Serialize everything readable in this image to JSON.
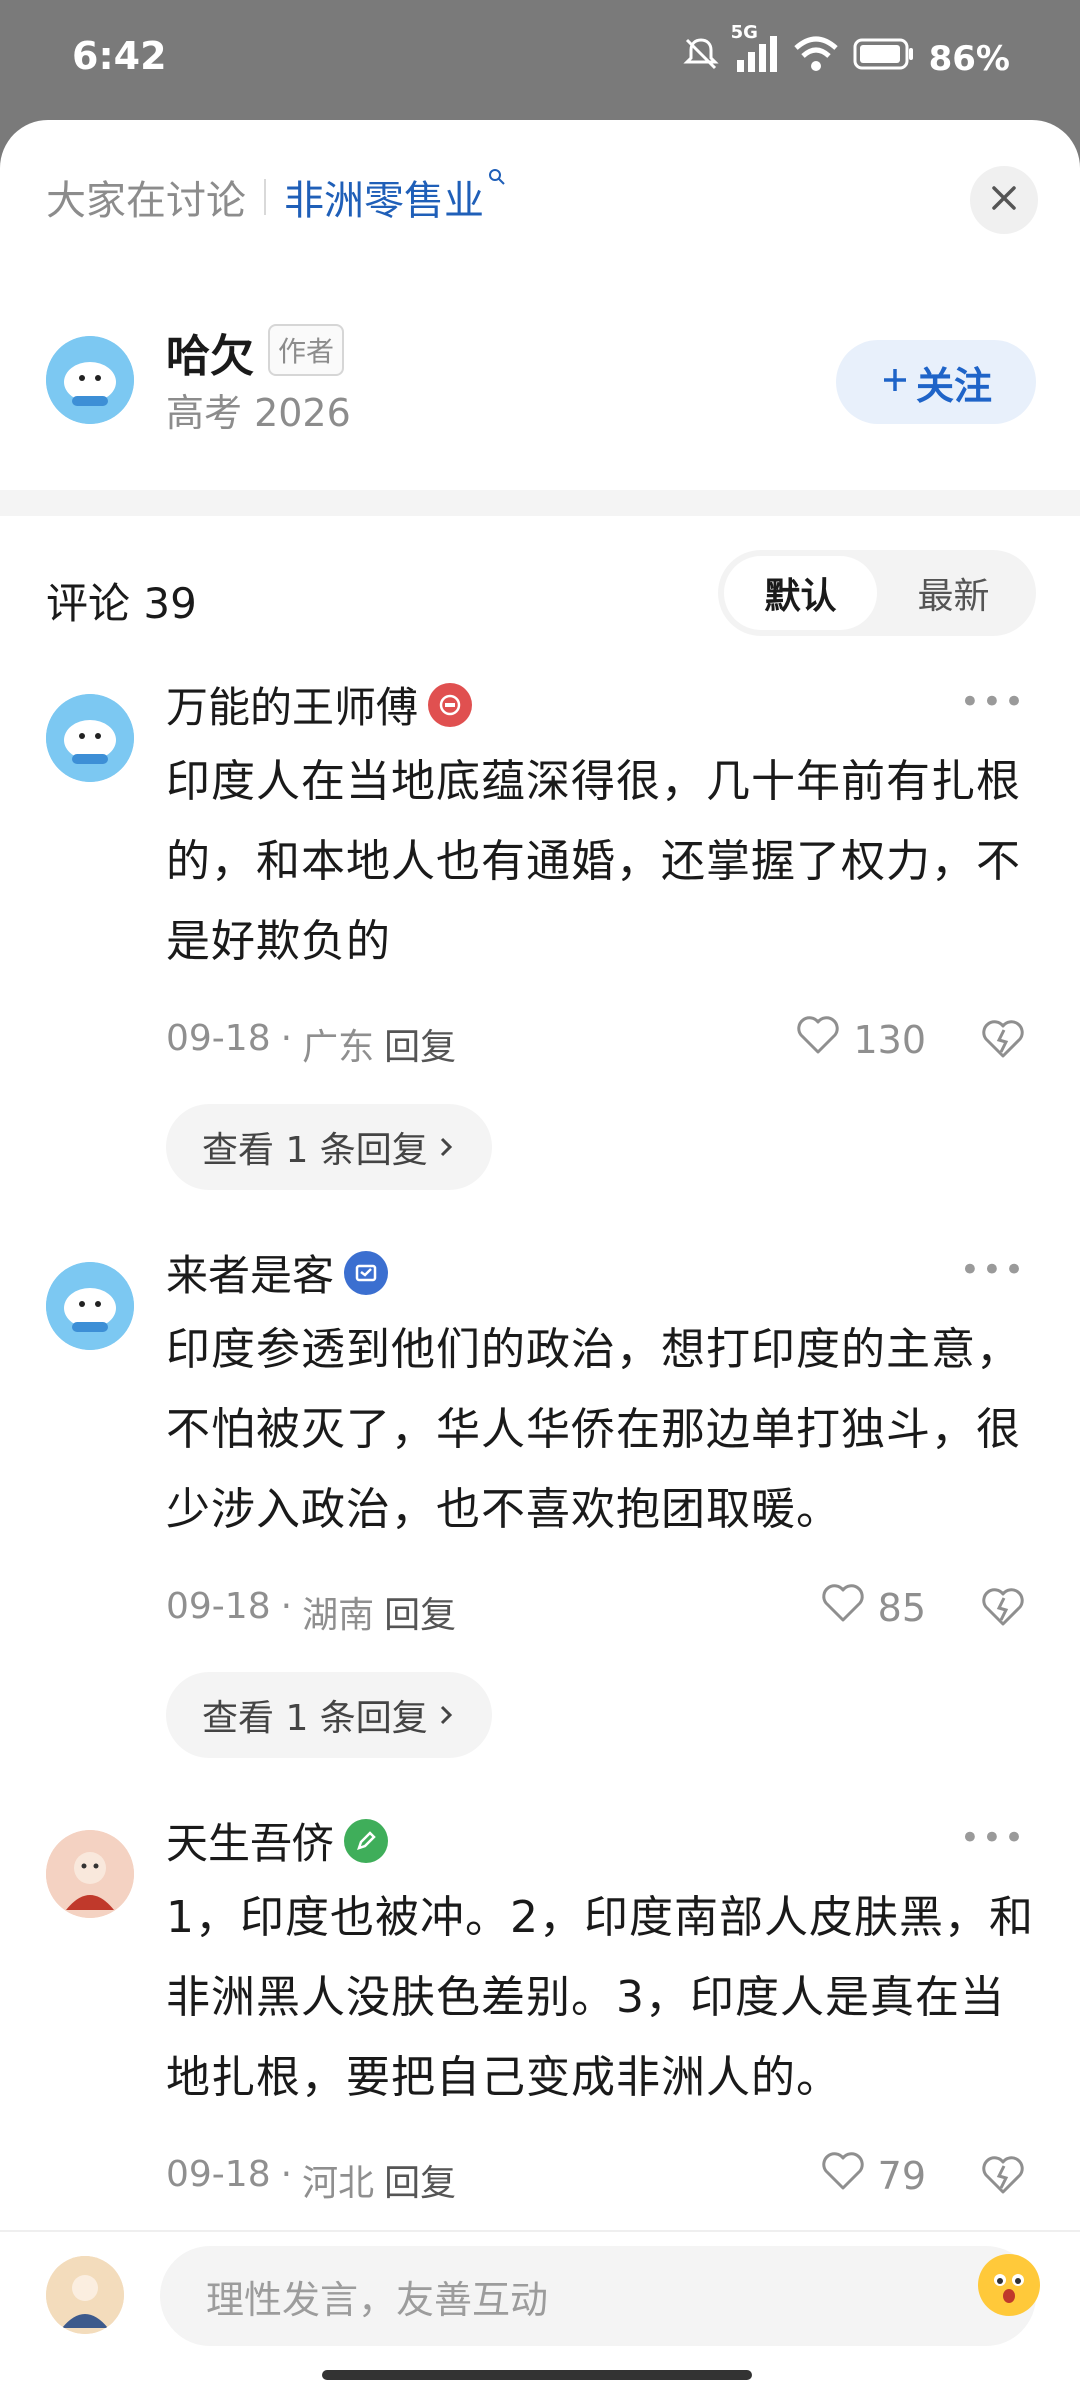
{
  "status_bar": {
    "time": "6:42",
    "network": "5G",
    "battery": "86%"
  },
  "topic": {
    "lead": "大家在讨论",
    "name": "非洲零售业"
  },
  "author": {
    "name": "哈欠",
    "tag": "作者",
    "subtitle": "高考 2026",
    "follow_label": "关注"
  },
  "comments_header": {
    "title": "评论 39",
    "sort_default": "默认",
    "sort_latest": "最新"
  },
  "comments": [
    {
      "name": "万能的王师傅",
      "text": "印度人在当地底蕴深得很，几十年前有扎根的，和本地人也有通婚，还掌握了权力，不是好欺负的",
      "date": "09-18",
      "location": "广东",
      "reply": "回复",
      "likes": "130",
      "view_replies": "查看 1 条回复"
    },
    {
      "name": "来者是客",
      "text": "印度参透到他们的政治，想打印度的主意，不怕被灭了，华人华侨在那边单打独斗，很少涉入政治，也不喜欢抱团取暖。",
      "date": "09-18",
      "location": "湖南",
      "reply": "回复",
      "likes": "85",
      "view_replies": "查看 1 条回复"
    },
    {
      "name": "天生吾侪",
      "text": "1，印度也被冲。2，印度南部人皮肤黑，和非洲黑人没肤色差别。3，印度人是真在当地扎根，要把自己变成非洲人的。",
      "date": "09-18",
      "location": "河北",
      "reply": "回复",
      "likes": "79"
    }
  ],
  "input": {
    "placeholder": "理性发言，友善互动"
  },
  "icons": [
    "mute-icon",
    "signal-icon",
    "wifi-icon",
    "battery-icon",
    "search-icon",
    "close-icon",
    "plus-icon",
    "more-icon",
    "heart-icon",
    "dislike-icon",
    "chevron-right-icon",
    "emoji-icon"
  ],
  "colors": {
    "accent": "#1f5fb8",
    "follow_bg": "#e8f0fb",
    "avatar_blue": "#6fc3f0"
  }
}
